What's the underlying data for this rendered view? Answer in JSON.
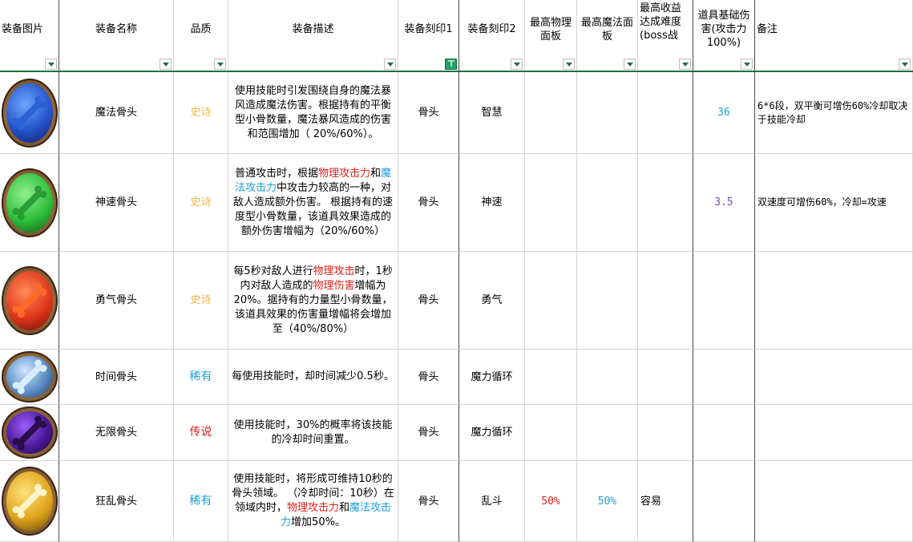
{
  "headers": {
    "image": "装备图片",
    "name": "装备名称",
    "quality": "品质",
    "desc": "装备描述",
    "imprint1": "装备刻印1",
    "imprint2": "装备刻印2",
    "max_phys": "最高物理面板",
    "max_magic": "最高魔法面板",
    "max_diff": "最高收益达成难度(boss战",
    "base_dmg": "道具基础伤害(攻击力100%)",
    "note": "备注"
  },
  "colors": {
    "header_underline": "#1e7145",
    "filter_active": "#21a366",
    "epic": "#f4b942",
    "rare": "#1e9fd6",
    "legend": "#e0201b",
    "highlight_red": "#e0201b",
    "highlight_blue": "#1e9fd6",
    "purple_number": "#7a4aa8"
  },
  "rows": [
    {
      "icon": "blue-bone-icon",
      "name": "魔法骨头",
      "quality": "史诗",
      "desc": [
        {
          "t": "使用技能时引发围绕自身的魔法暴风造成魔法伤害。根据持有的平衡型小骨数量，魔法暴风造成的伤害和范围增加（ 20%/60%）。",
          "c": ""
        }
      ],
      "imprint1": "骨头",
      "imprint2": "智慧",
      "max_phys": "",
      "max_magic": "",
      "max_diff": "",
      "base_dmg": "36",
      "note": "6*6段，双平衡可增伤60%冷却取决于技能冷却"
    },
    {
      "icon": "green-bone-icon",
      "name": "神速骨头",
      "quality": "史诗",
      "desc": [
        {
          "t": "普通攻击时，根据",
          "c": ""
        },
        {
          "t": "物理攻击力",
          "c": "red"
        },
        {
          "t": "和",
          "c": ""
        },
        {
          "t": "魔法攻击力",
          "c": "blue"
        },
        {
          "t": "中攻击力较高的一种，对敌人造成额外伤害。 根据持有的速度型小骨数量，该道具效果造成的额外伤害增幅为（20%/60%）",
          "c": ""
        }
      ],
      "imprint1": "骨头",
      "imprint2": "神速",
      "max_phys": "",
      "max_magic": "",
      "max_diff": "",
      "base_dmg": "3.5",
      "note": "双速度可增伤60%，冷却=攻速"
    },
    {
      "icon": "red-bone-icon",
      "name": "勇气骨头",
      "quality": "史诗",
      "desc": [
        {
          "t": "每5秒对敌人进行",
          "c": ""
        },
        {
          "t": "物理攻击",
          "c": "red"
        },
        {
          "t": "时，1秒内对敌人造成的",
          "c": ""
        },
        {
          "t": "物理伤害",
          "c": "red"
        },
        {
          "t": "增幅为20%。据持有的力量型小骨数量，该道具效果的伤害量增幅将会增加至（40%/80%）",
          "c": ""
        }
      ],
      "imprint1": "骨头",
      "imprint2": "勇气",
      "max_phys": "",
      "max_magic": "",
      "max_diff": "",
      "base_dmg": "",
      "note": ""
    },
    {
      "icon": "steel-bone-icon",
      "name": "时间骨头",
      "quality": "稀有",
      "desc": [
        {
          "t": "每使用技能时，却时间减少0.5秒。",
          "c": ""
        }
      ],
      "imprint1": "骨头",
      "imprint2": "魔力循环",
      "max_phys": "",
      "max_magic": "",
      "max_diff": "",
      "base_dmg": "",
      "note": ""
    },
    {
      "icon": "purple-ribcage-icon",
      "name": "无限骨头",
      "quality": "传说",
      "desc": [
        {
          "t": "使用技能时，30%的概率将该技能的冷却时间重置。",
          "c": ""
        }
      ],
      "imprint1": "骨头",
      "imprint2": "魔力循环",
      "max_phys": "",
      "max_magic": "",
      "max_diff": "",
      "base_dmg": "",
      "note": ""
    },
    {
      "icon": "golden-bone-icon",
      "name": "狂乱骨头",
      "quality": "稀有",
      "desc": [
        {
          "t": "使用技能时，将形成可维持10秒的骨头领域。 （冷却时间：10秒）在领域内时，",
          "c": ""
        },
        {
          "t": "物理攻击力",
          "c": "red"
        },
        {
          "t": "和",
          "c": ""
        },
        {
          "t": "魔法攻击力",
          "c": "blue"
        },
        {
          "t": "增加50%。",
          "c": ""
        }
      ],
      "imprint1": "骨头",
      "imprint2": "乱斗",
      "max_phys": "50%",
      "max_magic": "50%",
      "max_diff": "容易",
      "base_dmg": "",
      "note": ""
    }
  ]
}
